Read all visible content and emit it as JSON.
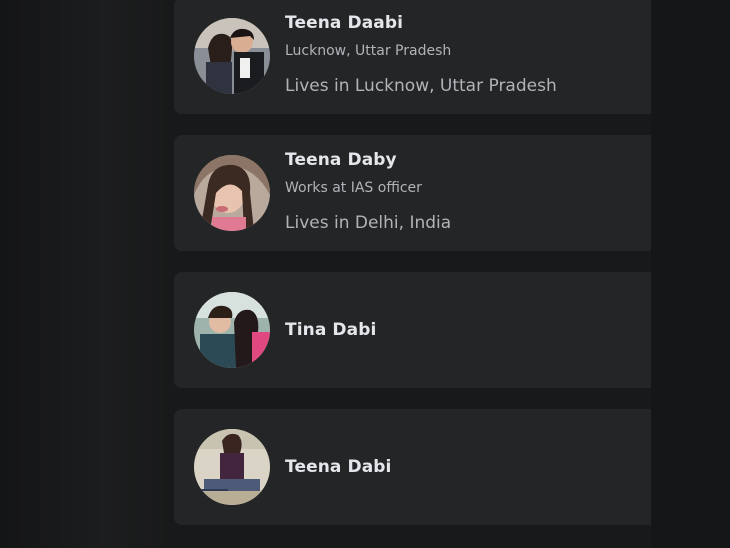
{
  "results": [
    {
      "name": "Teena Daabi",
      "subtitle": "Lucknow, Uttar Pradesh",
      "detail": "Lives in Lucknow, Uttar Pradesh"
    },
    {
      "name": "Teena Daby",
      "subtitle": "Works at IAS officer",
      "detail": "Lives in Delhi, India"
    },
    {
      "name": "Tina Dabi"
    },
    {
      "name": "Teena Dabi"
    }
  ],
  "colors": {
    "page_background": "#18191a",
    "card_background": "#242526",
    "primary_text": "#e4e6eb",
    "secondary_text": "#b0b3b8"
  }
}
